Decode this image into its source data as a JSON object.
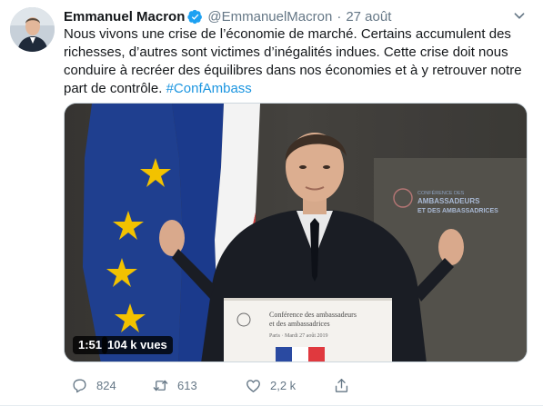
{
  "tweet": {
    "author_name": "Emmanuel Macron",
    "handle": "@EmmanuelMacron",
    "separator": "·",
    "date": "27 août",
    "text_main": "Nous vivons une crise de l’économie de marché. Certains accumulent des richesses, d’autres sont victimes d’inégalités indues. Cette crise doit nous conduire à recréer des équilibres dans nos économies et à y retrouver notre part de contrôle.",
    "hashtag": "#ConfAmbass",
    "verified_icon": "verified-badge-icon",
    "accent_color": "#1da1f2"
  },
  "media": {
    "duration": "1:51",
    "views": "104 k vues",
    "podium_line1": "Conférence des ambassadeurs",
    "podium_line2": "et des ambassadrices",
    "podium_line3": "Paris · Mardi 27 août 2019",
    "logo_line1": "CONFÉRENCE DES",
    "logo_line2": "AMBASSADEURS",
    "logo_line3": "ET DES AMBASSADRICES"
  },
  "actions": {
    "reply_count": "824",
    "retweet_count": "613",
    "like_count": "2,2 k",
    "reply_icon": "reply-icon",
    "retweet_icon": "retweet-icon",
    "like_icon": "heart-icon",
    "share_icon": "share-icon"
  }
}
